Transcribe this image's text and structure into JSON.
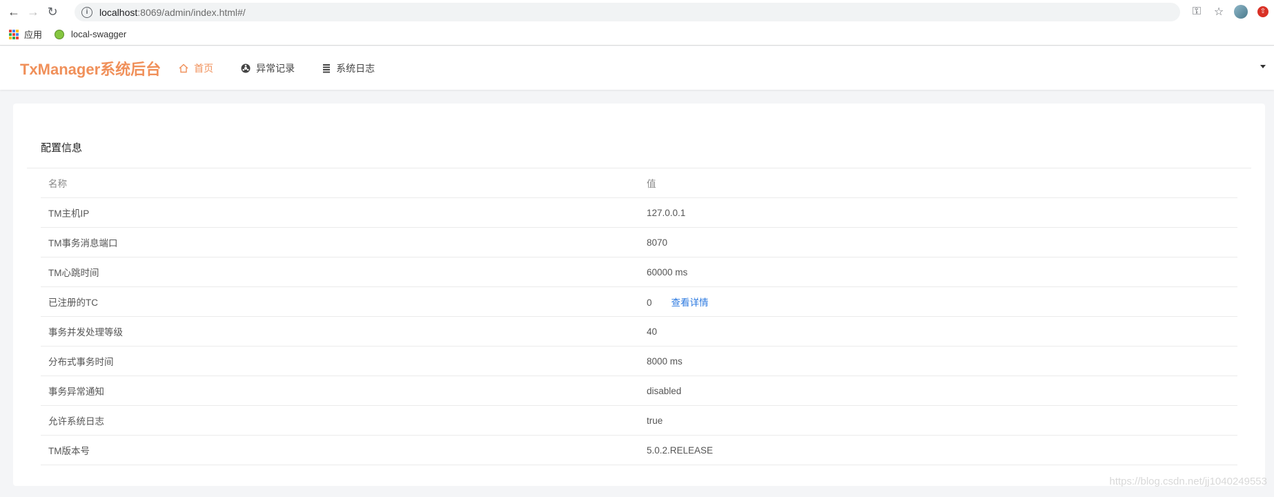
{
  "browser": {
    "url_host": "localhost",
    "url_rest": ":8069/admin/index.html#/",
    "bookmarks": [
      {
        "label": "应用",
        "icon": "apps-grid-icon"
      },
      {
        "label": "local-swagger",
        "icon": "swagger-icon"
      }
    ]
  },
  "header": {
    "brand": "TxManager系统后台",
    "menu": [
      {
        "label": "首页",
        "icon": "home-icon",
        "active": true
      },
      {
        "label": "异常记录",
        "icon": "exception-icon",
        "active": false
      },
      {
        "label": "系统日志",
        "icon": "list-icon",
        "active": false
      }
    ]
  },
  "card": {
    "title": "配置信息",
    "columns": [
      "名称",
      "值"
    ],
    "rows": [
      {
        "name": "TM主机IP",
        "value": "127.0.0.1"
      },
      {
        "name": "TM事务消息端口",
        "value": "8070"
      },
      {
        "name": "TM心跳时间",
        "value": "60000 ms"
      },
      {
        "name": "已注册的TC",
        "value": "0",
        "link": "查看详情"
      },
      {
        "name": "事务并发处理等级",
        "value": "40"
      },
      {
        "name": "分布式事务时间",
        "value": "8000 ms"
      },
      {
        "name": "事务异常通知",
        "value": "disabled"
      },
      {
        "name": "允许系统日志",
        "value": "true"
      },
      {
        "name": "TM版本号",
        "value": "5.0.2.RELEASE"
      }
    ]
  },
  "watermark": "https://blog.csdn.net/jj1040249553",
  "colors": {
    "accent": "#f0905a",
    "link": "#2e7be0"
  }
}
